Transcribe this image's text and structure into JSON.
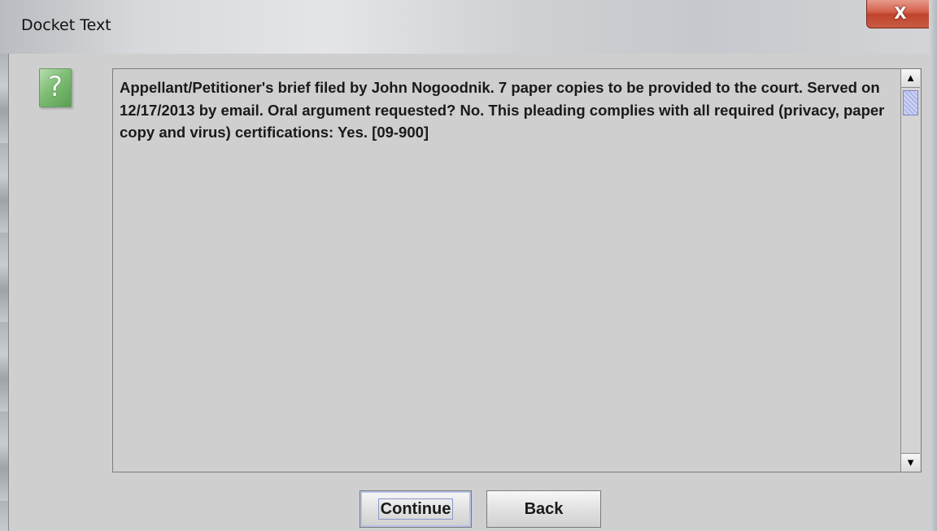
{
  "window": {
    "title": "Docket Text",
    "close_icon": "close-icon",
    "close_glyph": "X"
  },
  "dialog": {
    "icon": "question-icon",
    "icon_glyph": "?",
    "docket_text": "Appellant/Petitioner's brief filed by John Nogoodnik. 7 paper copies to be provided to the court. Served on 12/17/2013 by email. Oral argument requested? No. This pleading complies with all required (privacy, paper copy and virus) certifications: Yes. [09-900]",
    "scroll_up_glyph": "▲",
    "scroll_down_glyph": "▼"
  },
  "buttons": {
    "continue_label": "Continue",
    "back_label": "Back"
  }
}
